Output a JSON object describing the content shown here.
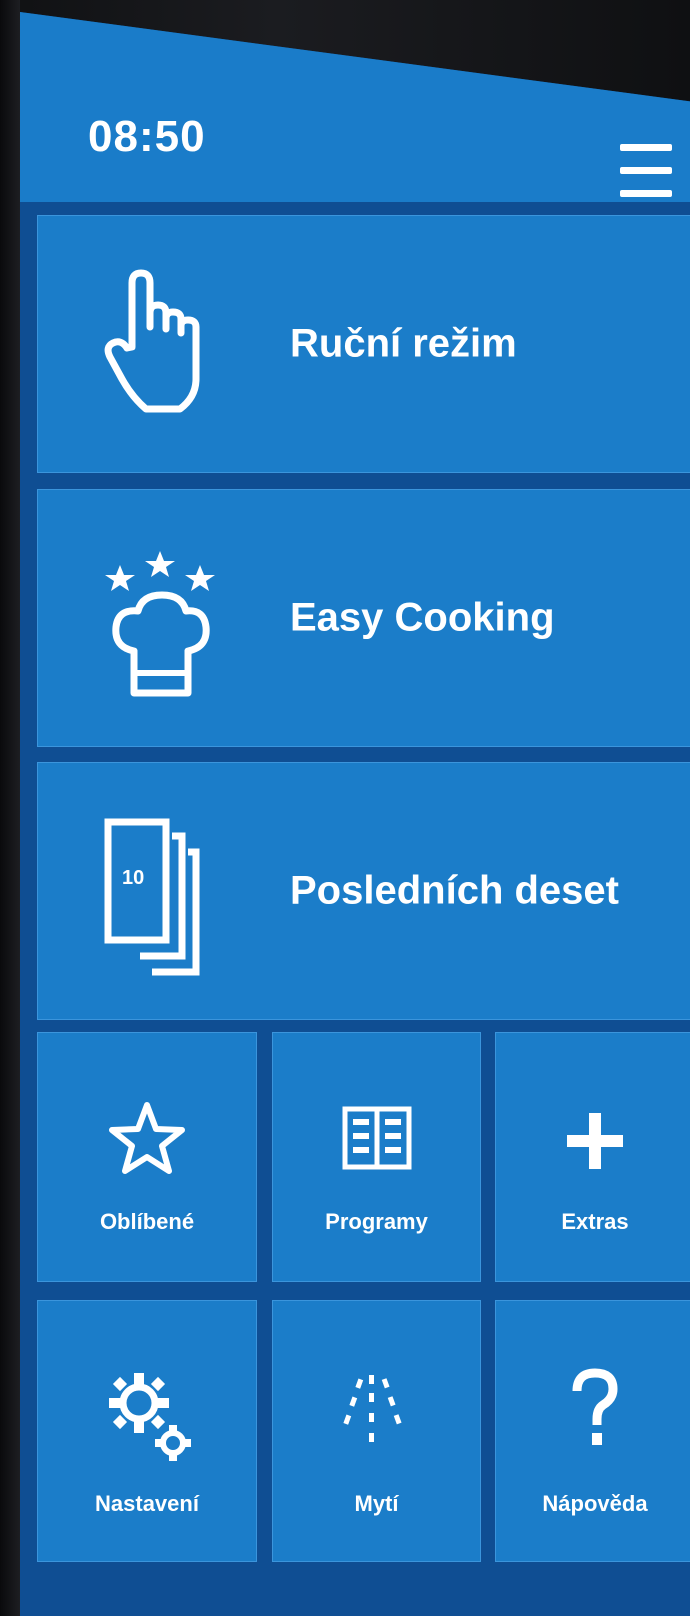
{
  "status_bar": {
    "time": "08:50",
    "menu_icon": "hamburger-menu-icon"
  },
  "main_tiles": [
    {
      "label": "Ruční režim",
      "icon": "pointing-hand-icon"
    },
    {
      "label": "Easy Cooking",
      "icon": "chef-hat-stars-icon"
    },
    {
      "label": "Posledních deset",
      "icon": "recent-ten-stack-icon",
      "icon_text": "10"
    }
  ],
  "grid_tiles": [
    {
      "label": "Oblíbené",
      "icon": "star-icon"
    },
    {
      "label": "Programy",
      "icon": "book-icon"
    },
    {
      "label": "Extras",
      "icon": "plus-icon"
    },
    {
      "label": "Nastavení",
      "icon": "gears-icon"
    },
    {
      "label": "Mytí",
      "icon": "spray-icon"
    },
    {
      "label": "Nápověda",
      "icon": "question-icon"
    }
  ],
  "colors": {
    "tile_blue": "#1b7dc9",
    "background_blue": "#0f4e93",
    "text": "#ffffff"
  }
}
